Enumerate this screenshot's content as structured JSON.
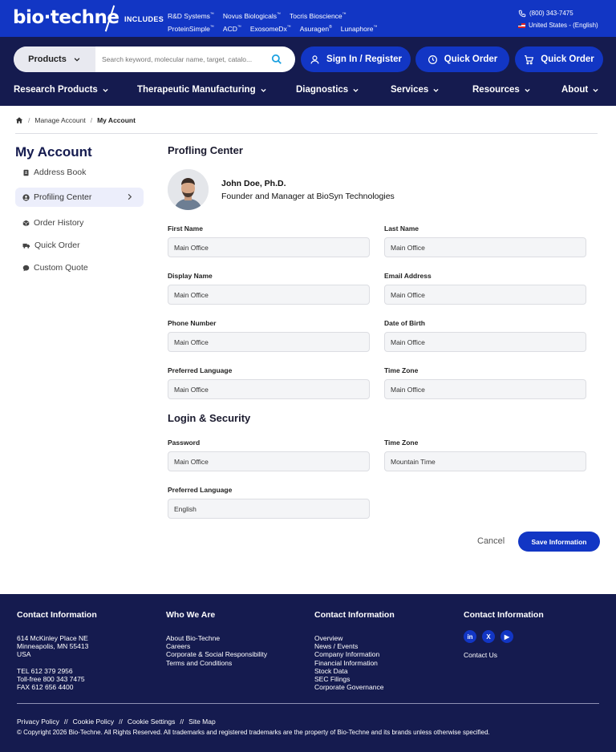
{
  "topbar": {
    "logo": "bio·techne",
    "includes": "INCLUDES",
    "brands_row1": [
      {
        "name": "R&D Systems",
        "tm": "™"
      },
      {
        "name": "Novus Biologicals",
        "tm": "™"
      },
      {
        "name": "Tocris Bioscience",
        "tm": "™"
      }
    ],
    "brands_row2": [
      {
        "name": "ProteinSimple",
        "tm": "™"
      },
      {
        "name": "ACD",
        "tm": "™"
      },
      {
        "name": "ExosomeDx",
        "tm": "™"
      },
      {
        "name": "Asuragen",
        "tm": "®"
      },
      {
        "name": "Lunaphore",
        "tm": "™"
      }
    ],
    "phone": "(800) 343-7475",
    "region": "United States - (English)"
  },
  "nav": {
    "products_label": "Products",
    "search_placeholder": "Search keyword, molecular name, target, catalo...",
    "sign_in": "Sign In / Register",
    "quick_order_1": "Quick Order",
    "quick_order_2": "Quick Order",
    "menu": [
      "Research Products",
      "Therapeutic Manufacturing",
      "Diagnostics",
      "Services",
      "Resources",
      "About"
    ]
  },
  "breadcrumb": {
    "manage": "Manage Account",
    "current": "My Account"
  },
  "sidebar": {
    "title": "My Account",
    "items": [
      "Address Book",
      "Profiling Center",
      "Order History",
      "Quick Order",
      "Custom Quote"
    ]
  },
  "profile": {
    "section_title": "Profling Center",
    "name": "John Doe, Ph.D.",
    "role": "Founder and Manager at BioSyn Technologies",
    "fields": [
      {
        "label": "First Name",
        "value": "Main Office"
      },
      {
        "label": "Last Name",
        "value": "Main Office"
      },
      {
        "label": "Display Name",
        "value": "Main Office"
      },
      {
        "label": "Email Address",
        "value": "Main Office"
      },
      {
        "label": "Phone Number",
        "value": "Main Office"
      },
      {
        "label": "Date of Birth",
        "value": "Main Office"
      },
      {
        "label": "Preferred Language",
        "value": "Main Office"
      },
      {
        "label": "Time Zone",
        "value": "Main Office"
      }
    ]
  },
  "security": {
    "section_title": "Login & Security",
    "fields": [
      {
        "label": "Password",
        "value": "Main Office"
      },
      {
        "label": "Time Zone",
        "value": "Mountain Time"
      },
      {
        "label": "Preferred Language",
        "value": "English"
      }
    ]
  },
  "actions": {
    "cancel": "Cancel",
    "save": "Save Information"
  },
  "footer": {
    "col1_title": "Contact Information",
    "address": [
      "614 McKinley Place NE",
      "Minneapolis, MN 55413",
      "USA"
    ],
    "phones": [
      "TEL 612 379 2956",
      "Toll-free 800 343 7475",
      "FAX 612 656 4400"
    ],
    "col2_title": "Who We Are",
    "col2_links": [
      "About Bio-Techne",
      "Careers",
      "Corporate & Social Responsibility",
      "Terms and Conditions"
    ],
    "col3_title": "Contact Information",
    "col3_links": [
      "Overview",
      "News / Events",
      "Company Information",
      "Financial Information",
      "Stock Data",
      "SEC Filings",
      "Corporate Governance"
    ],
    "col4_title": "Contact Information",
    "social": [
      "in",
      "X",
      "▶"
    ],
    "contact_us": "Contact Us",
    "bottom_links": [
      "Privacy Policy",
      "Cookie Policy",
      "Cookie Settings",
      "Site Map"
    ],
    "bottom_sep": "//",
    "copyright": "© Copyright 2026 Bio-Techne. All Rights Reserved. All trademarks and registered trademarks are the property of Bio-Techne and its brands unless otherwise specified."
  },
  "colors": {
    "brand_blue": "#1236c4",
    "navy": "#151b4f"
  }
}
